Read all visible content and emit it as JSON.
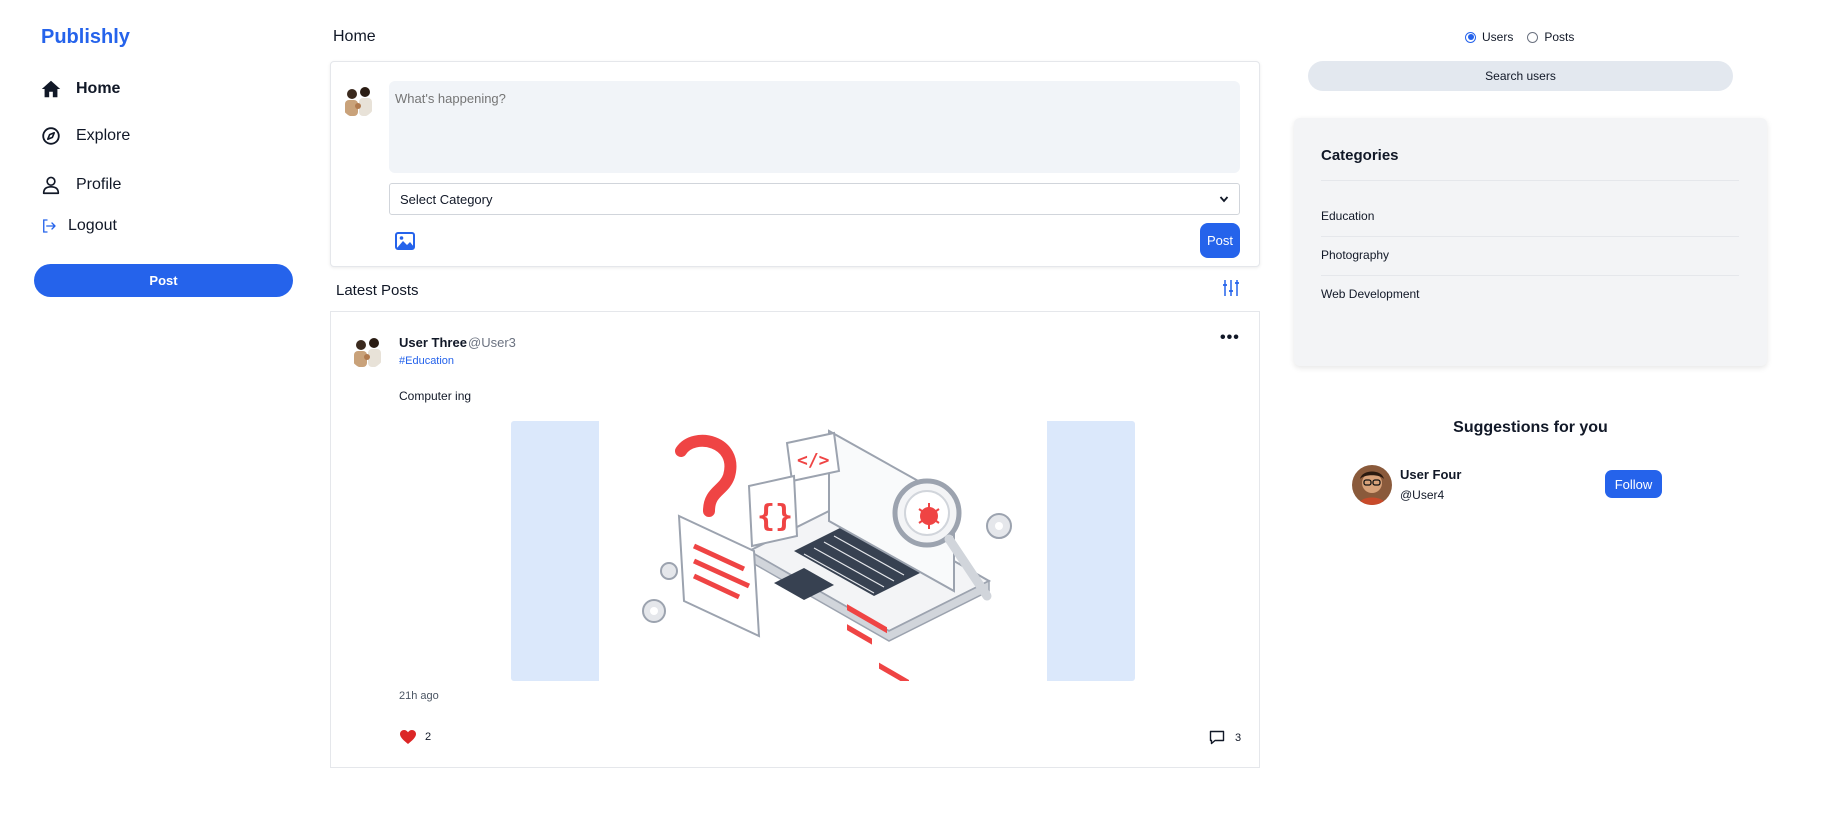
{
  "brand": "Publishly",
  "sidebar": {
    "items": [
      {
        "label": "Home",
        "icon": "home-icon"
      },
      {
        "label": "Explore",
        "icon": "compass-icon"
      },
      {
        "label": "Profile",
        "icon": "user-icon"
      },
      {
        "label": "Logout",
        "icon": "logout-icon"
      }
    ],
    "post_label": "Post"
  },
  "main": {
    "title": "Home",
    "composer": {
      "placeholder": "What's happening?",
      "category_label": "Select Category",
      "post_label": "Post"
    },
    "latest_title": "Latest Posts",
    "post": {
      "author": "User Three",
      "handle": "@User3",
      "tag": "#Education",
      "more": "•••",
      "text": "Computer ing",
      "time": "21h ago",
      "likes": "2",
      "comments": "3"
    }
  },
  "right": {
    "search_mode": {
      "users": "Users",
      "posts": "Posts",
      "selected": "Users"
    },
    "search_label": "Search users",
    "categories": {
      "title": "Categories",
      "items": [
        "Education",
        "Photography",
        "Web Development"
      ]
    },
    "suggestions": {
      "title": "Suggestions for you",
      "user": {
        "name": "User Four",
        "handle": "@User4",
        "follow_label": "Follow"
      }
    }
  },
  "colors": {
    "accent": "#2563eb",
    "heart": "#dc2626",
    "image_bg": "#dbe8fb"
  }
}
